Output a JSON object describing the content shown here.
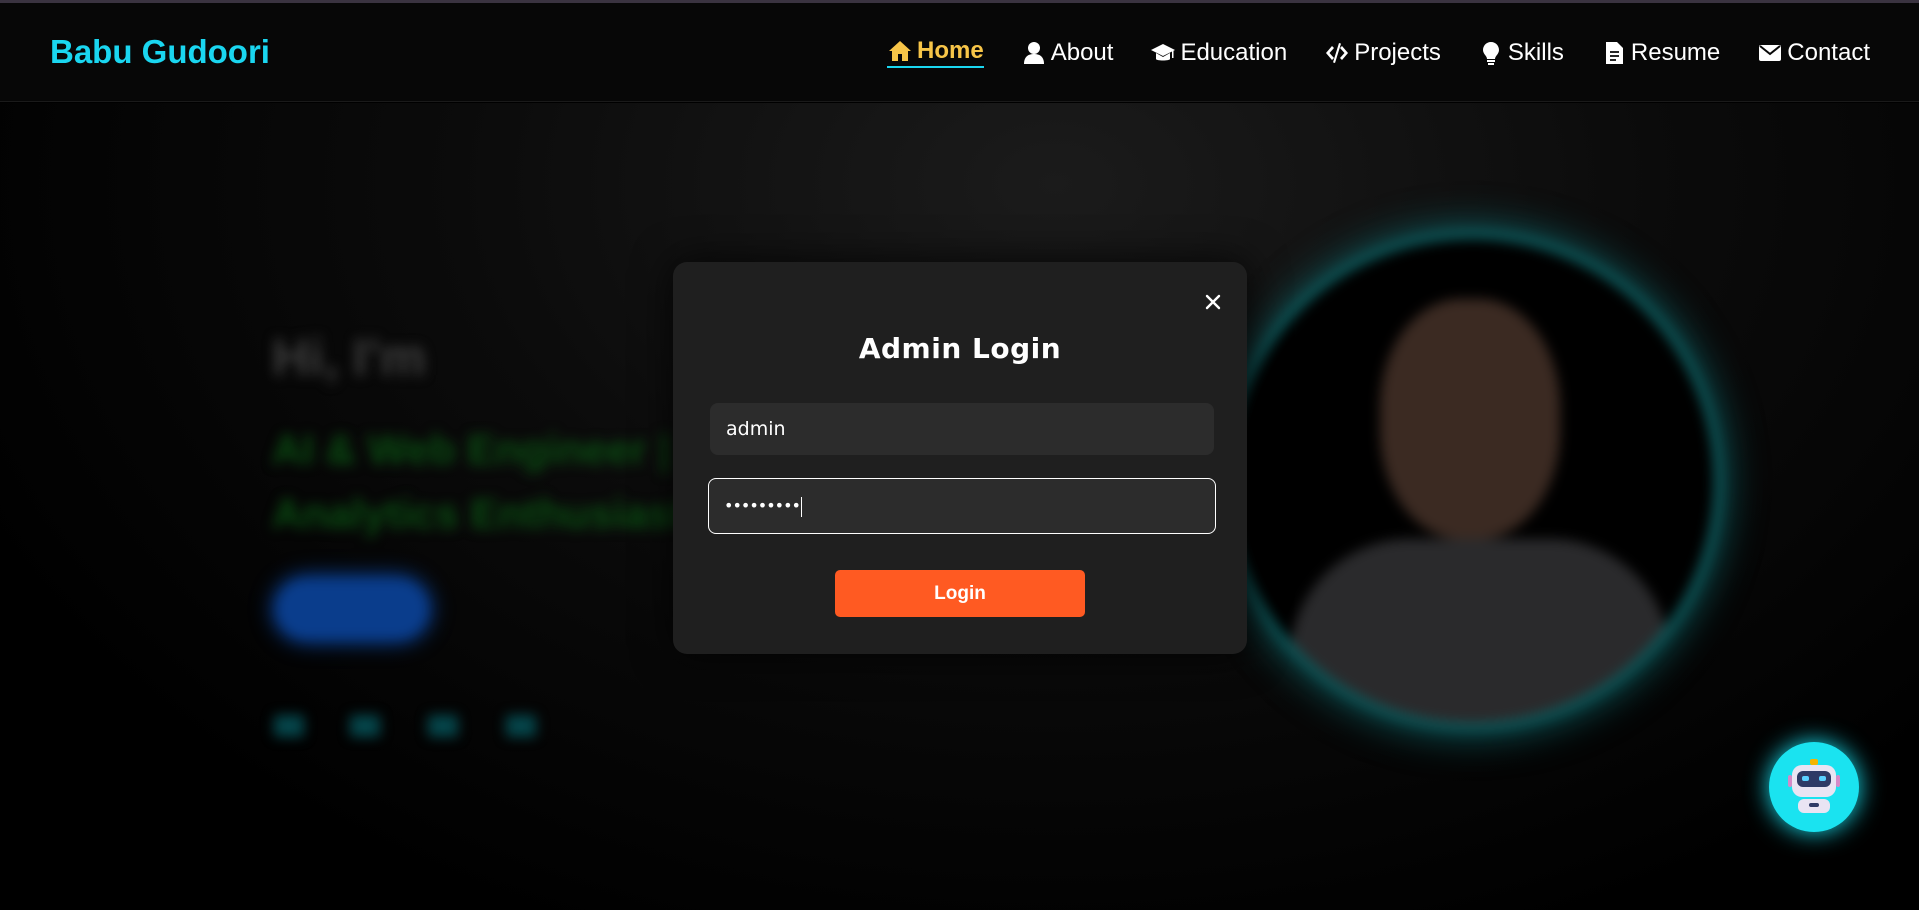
{
  "navbar": {
    "brand": "Babu Gudoori",
    "items": [
      {
        "label": "Home",
        "icon": "home-icon",
        "active": true
      },
      {
        "label": "About",
        "icon": "user-icon",
        "active": false
      },
      {
        "label": "Education",
        "icon": "graduation-cap-icon",
        "active": false
      },
      {
        "label": "Projects",
        "icon": "code-icon",
        "active": false
      },
      {
        "label": "Skills",
        "icon": "lightbulb-icon",
        "active": false
      },
      {
        "label": "Resume",
        "icon": "document-icon",
        "active": false
      },
      {
        "label": "Contact",
        "icon": "envelope-icon",
        "active": false
      }
    ]
  },
  "hero": {
    "greeting": "Hi, I'm",
    "role_line1": "AI & Web Engineer |",
    "role_line2": "Analytics Enthusiast"
  },
  "modal": {
    "title": "Admin Login",
    "username_value": "admin",
    "password_value": "•••••••••",
    "login_label": "Login"
  },
  "colors": {
    "brand": "#1ad6f0",
    "active_nav": "#f7c548",
    "login_button": "#ff5a22",
    "modal_bg": "#1f1f1f",
    "chatbot": "#1ae3f0"
  }
}
